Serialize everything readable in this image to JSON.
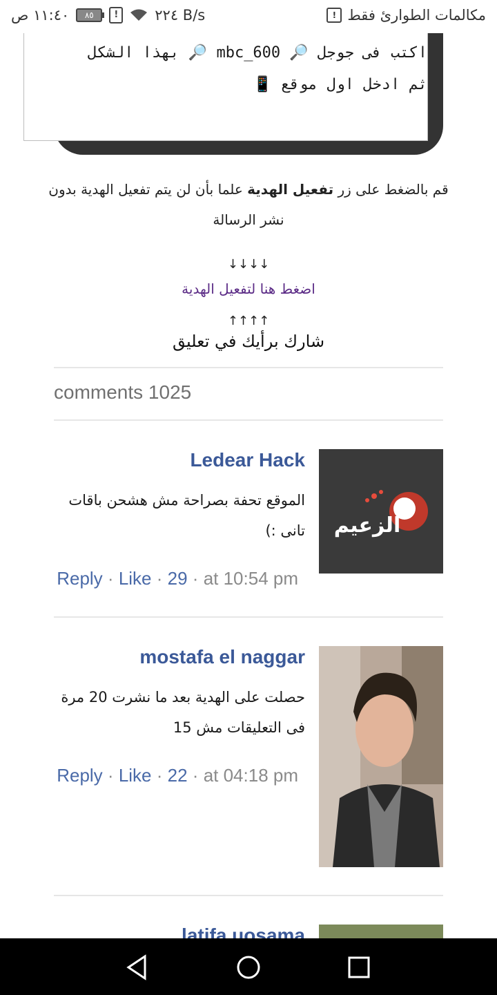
{
  "status_bar": {
    "time": "١١:٤٠ ص",
    "battery": "٨٥",
    "speed": "٢٢٤ B/s",
    "carrier": "مكالمات الطوارئ فقط",
    "icons": [
      "battery-icon",
      "sim-alert-icon",
      "wifi-icon",
      "notification-icon"
    ]
  },
  "textbox": {
    "line1": "اكتب فى جوجل 🔎 mbc_600 🔎 بهذا الشكل",
    "line2": "ثم ادخل اول موقع 📱"
  },
  "instruction": {
    "part1": "قم بالضغط على زر ",
    "bold": "تفعيل الهدية",
    "part2": " علما بأن لن يتم تفعيل الهدية بدون نشر الرسالة"
  },
  "arrows_down": "↓↓↓↓",
  "activate_link": "اضغط هنا لتفعيل الهدية",
  "arrows_up": "↑↑↑↑",
  "share_text": "شارك برأيك في تعليق",
  "comments_count": "comments 1025",
  "comments": [
    {
      "name": "Ledear Hack",
      "text": "الموقع تحفة بصراحة مش هشحن باقات تانى :)",
      "reply": "Reply",
      "like": "Like",
      "likes": "29",
      "time": "at 10:54 pm",
      "avatar_text": "الزعيم"
    },
    {
      "name": "mostafa el naggar",
      "text": "حصلت على الهدية بعد ما نشرت 20 مرة فى التعليقات مش 15",
      "reply": "Reply",
      "like": "Like",
      "likes": "22",
      "time": "at 04:18 pm"
    },
    {
      "name": "latifa uosama"
    }
  ],
  "colors": {
    "name": "#3b5998",
    "link": "#5b2b86",
    "frame": "#333333"
  }
}
